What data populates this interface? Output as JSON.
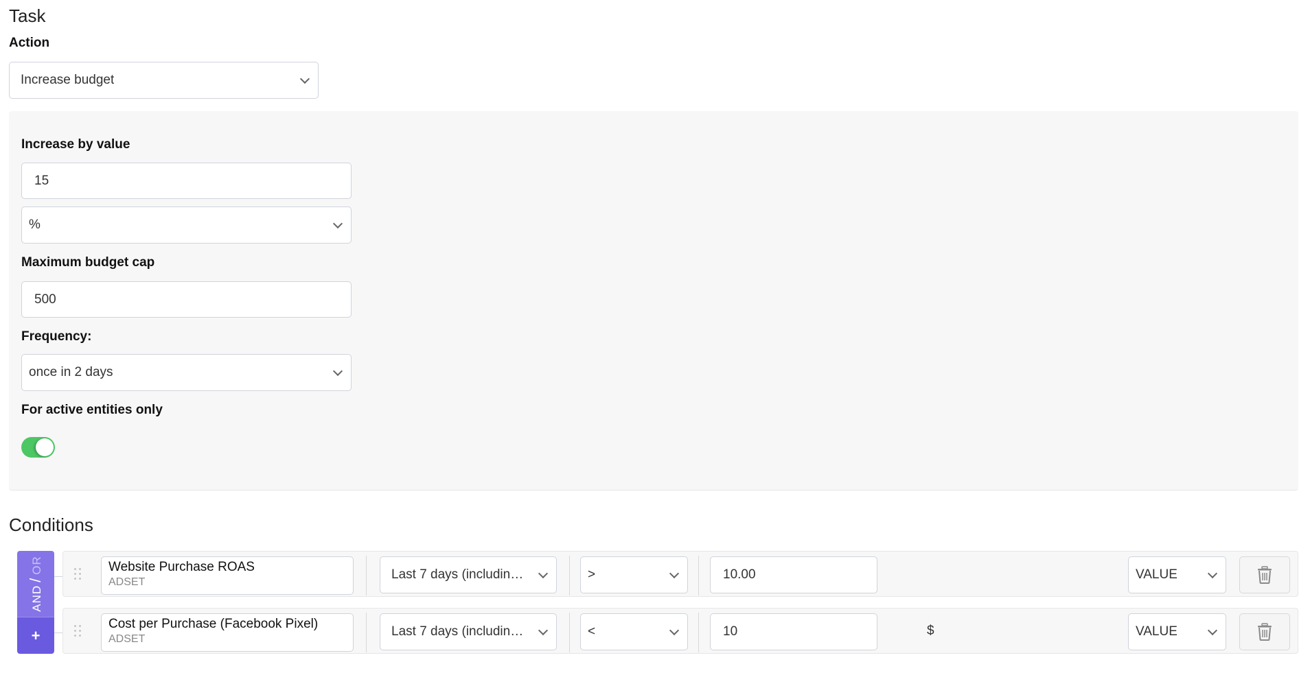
{
  "task": {
    "heading": "Task",
    "action_label": "Action",
    "action_value": "Increase budget",
    "increase_label": "Increase by value",
    "increase_value": "15",
    "unit_value": "%",
    "cap_label": "Maximum budget cap",
    "cap_value": "500",
    "frequency_label": "Frequency:",
    "frequency_value": "once in 2 days",
    "active_only_label": "For active entities only",
    "active_only_on": true
  },
  "conditions": {
    "heading": "Conditions",
    "logic_and": "AND",
    "logic_slash": "/",
    "logic_or": "OR",
    "logic_active": "AND",
    "add_label": "+",
    "rows": [
      {
        "metric": "Website Purchase ROAS",
        "level": "ADSET",
        "period": "Last 7 days (includin…",
        "operator": ">",
        "value": "10.00",
        "unit": "",
        "value_type": "VALUE"
      },
      {
        "metric": "Cost per Purchase (Facebook Pixel)",
        "level": "ADSET",
        "period": "Last 7 days (includin…",
        "operator": "<",
        "value": "10",
        "unit": "$",
        "value_type": "VALUE"
      }
    ]
  },
  "colors": {
    "toggle_on": "#4cc764",
    "andor_bg": "#8474e8",
    "add_bg": "#6a5ae0"
  }
}
